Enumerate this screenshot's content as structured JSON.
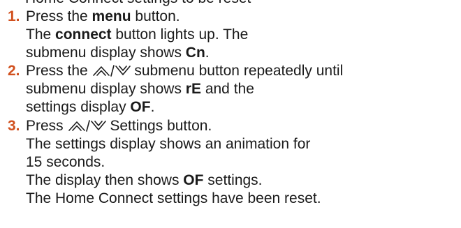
{
  "clipped_header": "Home Connect settings to be reset",
  "steps": [
    {
      "num": "1.",
      "l1_a": "Press the ",
      "l1_b": "menu",
      "l1_c": " button.",
      "l2_a": "The ",
      "l2_b": "connect",
      "l2_c": " button lights up. The",
      "l3_a": "submenu display shows ",
      "l3_b": "Cn",
      "l3_c": "."
    },
    {
      "num": "2.",
      "l1_a": "Press the ",
      "l1_icon": "up-down-chevron-icon",
      "l1_c": " submenu button repeatedly until",
      "l2_a": "submenu display shows ",
      "l2_b": "rE",
      "l2_c": " and the",
      "l3_a": "settings display ",
      "l3_b": "OF",
      "l3_c": "."
    },
    {
      "num": "3.",
      "l1_a": "Press ",
      "l1_icon": "up-down-chevron-icon",
      "l1_c": " Settings button.",
      "l2": "The settings display shows an animation for",
      "l3": "15 seconds.",
      "l4_a": "The display then shows ",
      "l4_b": "OF",
      "l4_c": " settings.",
      "l5": "The Home Connect settings have been reset."
    }
  ],
  "colors": {
    "step_number": "#d1501e",
    "text": "#1a1a1a"
  }
}
